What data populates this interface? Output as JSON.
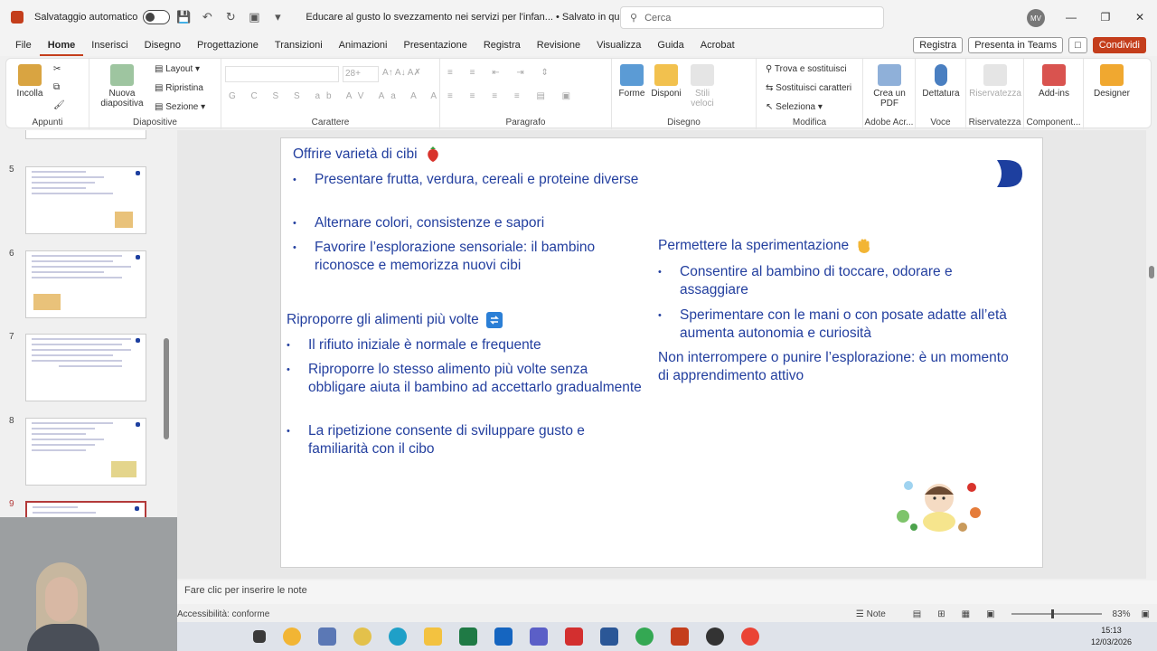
{
  "titlebar": {
    "autosave_label": "Salvataggio automatico",
    "doc_title": "Educare al gusto lo svezzamento nei servizi per l'infan... • Salvato in questo PC",
    "search_placeholder": "Cerca",
    "avatar_initials": "MV"
  },
  "menu": {
    "items": [
      "File",
      "Home",
      "Inserisci",
      "Disegno",
      "Progettazione",
      "Transizioni",
      "Animazioni",
      "Presentazione",
      "Registra",
      "Revisione",
      "Visualizza",
      "Guida",
      "Acrobat"
    ],
    "active": "Home",
    "registra_btn": "Registra",
    "teams_btn": "Presenta in Teams",
    "share_btn": "Condividi"
  },
  "ribbon": {
    "incolla": "Incolla",
    "appunti": "Appunti",
    "nuova_diapositiva": "Nuova diapositiva",
    "layout": "Layout",
    "ripristina": "Ripristina",
    "sezione": "Sezione",
    "diapositive": "Diapositive",
    "carattere": "Carattere",
    "font_size": "28+",
    "paragrafo": "Paragrafo",
    "forme": "Forme",
    "disponi": "Disponi",
    "stili_veloci": "Stili veloci",
    "disegno": "Disegno",
    "trova": "Trova e sostituisci",
    "sostituisci_caratteri": "Sostituisci caratteri",
    "seleziona": "Seleziona",
    "modifica": "Modifica",
    "crea_pdf": "Crea un PDF",
    "adobe": "Adobe Acr...",
    "dettatura": "Dettatura",
    "voce": "Voce",
    "riservatezza": "Riservatezza",
    "addins": "Add-ins",
    "componenti": "Component...",
    "designer": "Designer"
  },
  "thumbnails": {
    "numbers": [
      "5",
      "6",
      "7",
      "8",
      "9"
    ]
  },
  "slide": {
    "h1": "Offrire varietà di cibi",
    "b1": [
      "Presentare frutta, verdura, cereali e proteine diverse",
      "Alternare colori, consistenze e sapori",
      "Favorire l’esplorazione sensoriale: il bambino riconosce e memorizza nuovi cibi"
    ],
    "h2": "Riproporre gli alimenti più volte",
    "b2": [
      "Il rifiuto iniziale è normale e frequente",
      "Riproporre lo stesso alimento più volte senza obbligare aiuta il bambino ad accettarlo gradualmente",
      "La ripetizione consente di sviluppare gusto e familiarità con il cibo"
    ],
    "h3": "Permettere la sperimentazione",
    "b3": [
      "Consentire al bambino di toccare, odorare e assaggiare",
      "Sperimentare con le mani o con posate adatte all’età aumenta autonomia e curiosità"
    ],
    "closing": "Non interrompere o punire l’esplorazione: è un momento di apprendimento attivo"
  },
  "notes": {
    "placeholder": "Fare clic per inserire le note"
  },
  "status": {
    "accessibility": "Accessibilità: conforme",
    "notes_btn": "Note",
    "zoom": "83%"
  },
  "taskbar": {
    "time": "15:13",
    "date": "12/03/2026"
  }
}
